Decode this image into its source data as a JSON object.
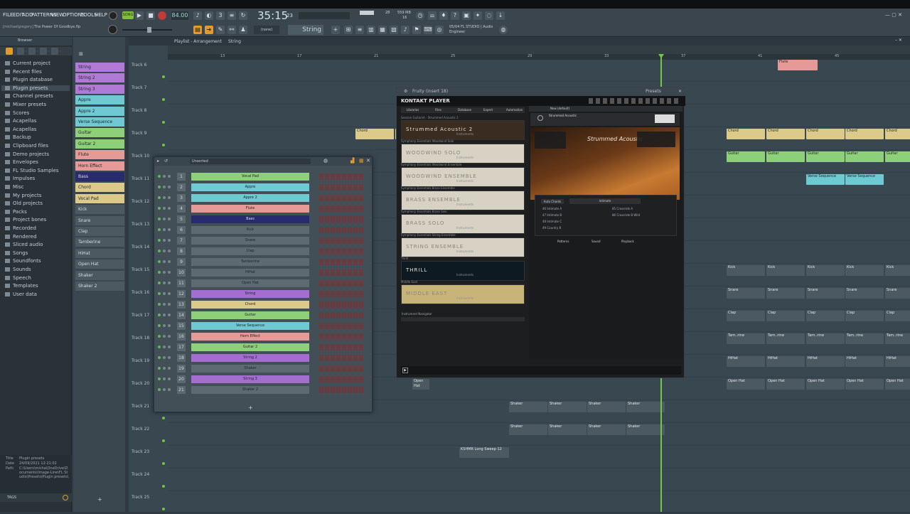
{
  "menu": [
    "FILE",
    "EDIT",
    "ADD",
    "PATTERNS",
    "VIEW",
    "OPTIONS",
    "TOOLS",
    "HELP"
  ],
  "transport": {
    "mode": "SONG",
    "tempo": "84.00",
    "time": "35:15",
    "time_small": "23",
    "cpu": "28",
    "mem": "559 MB",
    "mem2": "16"
  },
  "project": {
    "user": "[michaelgregory]",
    "title": "The Power Of Goodbye.flp"
  },
  "hint": {
    "line1": "05/04 FL STUDIO | Audio",
    "line2": "Engineer"
  },
  "snap": "(none)",
  "pattern": "String",
  "browser": {
    "title": "Browser",
    "items": [
      "Current project",
      "Recent files",
      "Plugin database",
      "Plugin presets",
      "Channel presets",
      "Mixer presets",
      "Scores",
      "Acapellas",
      "Acapellas",
      "Backup",
      "Clipboard files",
      "Demo projects",
      "Envelopes",
      "FL Studio Samples",
      "Impulses",
      "Misc",
      "My projects",
      "Old projects",
      "Packs",
      "Project bones",
      "Recorded",
      "Rendered",
      "Sliced audio",
      "Songs",
      "Soundfonts",
      "Sounds",
      "Speech",
      "Templates",
      "User data"
    ],
    "info": {
      "title_label": "Title",
      "title": "Plugin presets",
      "date_label": "Date",
      "date": "24/09/2021 12:21:02",
      "path_label": "Path",
      "path": "C:\\Users\\micha\\OneDrive\\Documents\\Image-Line\\FL Studio\\Presets\\Plugin presets\\"
    },
    "tags": "TAGS"
  },
  "picker": [
    {
      "n": "String",
      "c": "#b07ad6"
    },
    {
      "n": "String 2",
      "c": "#b07ad6"
    },
    {
      "n": "String 3",
      "c": "#b07ad6"
    },
    {
      "n": "Appre",
      "c": "#6fc9d2"
    },
    {
      "n": "Appre 2",
      "c": "#6fc9d2"
    },
    {
      "n": "Verse Sequence",
      "c": "#6fc9d2"
    },
    {
      "n": "Guitar",
      "c": "#8ed07a"
    },
    {
      "n": "Guitar 2",
      "c": "#8ed07a"
    },
    {
      "n": "Flute",
      "c": "#e59a98"
    },
    {
      "n": "Horn Effect",
      "c": "#e59a98"
    },
    {
      "n": "Bass",
      "c": "#2a2a6e"
    },
    {
      "n": "Chord",
      "c": "#dcca8a"
    },
    {
      "n": "Vocal Pad",
      "c": "#dcca8a"
    },
    {
      "n": "Kick",
      "c": "#4c5961"
    },
    {
      "n": "Snare",
      "c": "#4c5961"
    },
    {
      "n": "Clap",
      "c": "#4c5961"
    },
    {
      "n": "Tamberine",
      "c": "#4c5961"
    },
    {
      "n": "HiHat",
      "c": "#4c5961"
    },
    {
      "n": "Open Hat",
      "c": "#4c5961"
    },
    {
      "n": "Shaker",
      "c": "#4c5961"
    },
    {
      "n": "Shaker 2",
      "c": "#4c5961"
    }
  ],
  "playlist": {
    "title": "Playlist - Arrangement",
    "pattern": "String",
    "ruler": [
      "13",
      "17",
      "21",
      "25",
      "29",
      "33",
      "37",
      "41",
      "45"
    ],
    "tracks": [
      "Track 6",
      "Track 7",
      "Track 8",
      "Track 9",
      "Track 10",
      "Track 11",
      "Track 12",
      "Track 13",
      "Track 14",
      "Track 15",
      "Track 16",
      "Track 17",
      "Track 18",
      "Track 19",
      "Track 20",
      "Track 21",
      "Track 22",
      "Track 23",
      "Track 24",
      "Track 25"
    ],
    "clips": {
      "flute": "Flute",
      "chord": "Chord",
      "guitar": "Guitar",
      "verse": "Verse Sequence",
      "sequence": "uence",
      "kick": "Kick",
      "snare": "Snare",
      "clap": "Clap",
      "tam": "Tam..rine",
      "hihat": "HiHat",
      "openhat": "Open Hat",
      "shaker": "Shaker",
      "ksnare": "KSHMR Long Sweep 12"
    }
  },
  "rack": {
    "filter": "Unsorted",
    "channels": [
      {
        "n": "Vocal Pad",
        "c": "#8ed07a"
      },
      {
        "n": "Appre",
        "c": "#6fc9d2"
      },
      {
        "n": "Appre 2",
        "c": "#6fc9d2"
      },
      {
        "n": "Flute",
        "c": "#e59a98"
      },
      {
        "n": "Bass",
        "c": "#2a2a6e"
      },
      {
        "n": "Kick",
        "c": "#5d6a72"
      },
      {
        "n": "Snare",
        "c": "#5d6a72"
      },
      {
        "n": "Clap",
        "c": "#5d6a72"
      },
      {
        "n": "Tamberine",
        "c": "#5d6a72"
      },
      {
        "n": "HiHat",
        "c": "#5d6a72"
      },
      {
        "n": "Open Hat",
        "c": "#5d6a72"
      },
      {
        "n": "String",
        "c": "#a46ed1"
      },
      {
        "n": "Chord",
        "c": "#dcca8a"
      },
      {
        "n": "Guitar",
        "c": "#8ed07a"
      },
      {
        "n": "Verse Sequence",
        "c": "#6fc9d2"
      },
      {
        "n": "Horn Effect",
        "c": "#e59a98"
      },
      {
        "n": "Guitar 2",
        "c": "#8ed07a"
      },
      {
        "n": "String 2",
        "c": "#a46ed1"
      },
      {
        "n": "Shaker",
        "c": "#5d6a72"
      },
      {
        "n": "String 3",
        "c": "#a46ed1"
      },
      {
        "n": "Shaker 2",
        "c": "#5d6a72"
      }
    ],
    "add": "+"
  },
  "kontakt": {
    "window": "Fruity (insert 18)",
    "presets": "Presets",
    "brand": "KONTAKT PLAYER",
    "tabs": [
      "Libraries",
      "Files",
      "Database",
      "Expert",
      "Automation"
    ],
    "instrument": "Strummed Acoustic",
    "new": "New (default)",
    "libs": [
      {
        "cat": "Session Guitarist - Strummed Acoustic 2",
        "name": "Strummed Acoustic 2"
      },
      {
        "cat": "Symphony Essentials Woodwind Solo",
        "name": "WOODWIND SOLO"
      },
      {
        "cat": "Symphony Essentials Woodwind Ensemble",
        "name": "WOODWIND ENSEMBLE"
      },
      {
        "cat": "Symphony Essentials Brass Ensemble",
        "name": "BRASS ENSEMBLE"
      },
      {
        "cat": "Symphony Essentials Brass Solo",
        "name": "BRASS SOLO"
      },
      {
        "cat": "Symphony Essentials String Ensemble",
        "name": "STRING ENSEMBLE"
      },
      {
        "cat": "Thrill",
        "name": "THRILL"
      },
      {
        "cat": "Middle East",
        "name": "MIDDLE EAST"
      }
    ],
    "instruments_label": "Instruments",
    "nav": "Instrument Navigator",
    "product": "Strummed Acoustic",
    "pattern": "Intimate",
    "patterns": [
      "46 Intimate A",
      "47 Intimate B",
      "48 Intimate C",
      "49 Country B"
    ],
    "patterns2": [
      "85 Crossride A",
      "86 Crossride B Wild"
    ],
    "bottom_tabs": [
      "Patterns",
      "Sound",
      "Playback"
    ],
    "auto_chords": "Auto Chords"
  }
}
